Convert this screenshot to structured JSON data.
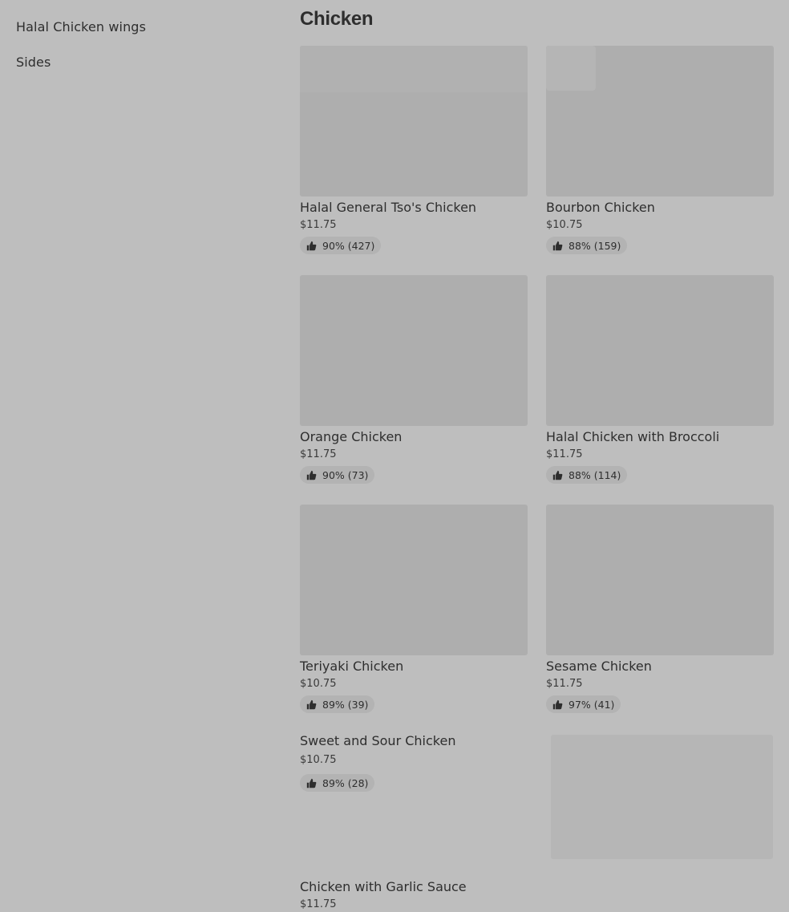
{
  "sidebar": {
    "items": [
      {
        "label": "Halal Chicken wings"
      },
      {
        "label": "Sides"
      }
    ]
  },
  "section": {
    "title": "Chicken"
  },
  "items": [
    {
      "name": "Halal General Tso's Chicken",
      "price": "$11.75",
      "rating": "90% (427)"
    },
    {
      "name": "Bourbon Chicken",
      "price": "$10.75",
      "rating": "88% (159)"
    },
    {
      "name": "Orange Chicken",
      "price": "$11.75",
      "rating": "90% (73)"
    },
    {
      "name": "Halal Chicken with Broccoli",
      "price": "$11.75",
      "rating": "88% (114)"
    },
    {
      "name": "Teriyaki Chicken",
      "price": "$10.75",
      "rating": "89% (39)"
    },
    {
      "name": "Sesame Chicken",
      "price": "$11.75",
      "rating": "97% (41)"
    },
    {
      "name": "Sweet and Sour Chicken",
      "price": "$10.75",
      "rating": "89% (28)"
    },
    {
      "name": "Chicken with Garlic Sauce",
      "price": "$11.75"
    }
  ],
  "icons": {
    "rating": "thumbs-up-icon"
  }
}
